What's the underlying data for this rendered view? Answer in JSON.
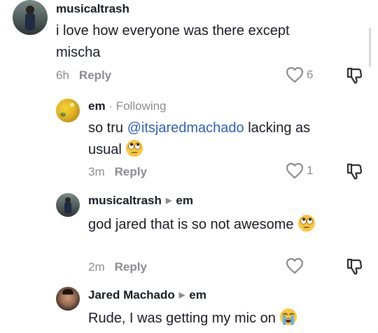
{
  "comments": [
    {
      "username": "musicaltrash",
      "text": "i love how everyone was there except mischa",
      "time": "6h",
      "reply_label": "Reply",
      "likes": "6"
    },
    {
      "username": "em",
      "following": "Following",
      "text_before": "so tru ",
      "mention": "@itsjaredmachado",
      "text_after": " lacking as usual",
      "emoji": "face-with-rolling-eyes",
      "time": "3m",
      "reply_label": "Reply",
      "likes": "1"
    },
    {
      "username": "musicaltrash",
      "reply_to": "em",
      "text": "god jared that is so not awesome",
      "emoji": "face-with-rolling-eyes",
      "time": "2m",
      "reply_label": "Reply",
      "likes": ""
    },
    {
      "username": "Jared Machado",
      "reply_to": "em",
      "text": "Rude, I was getting my mic on",
      "emoji": "loudly-crying-face"
    }
  ],
  "icons": {
    "heart": "heart-outline-icon",
    "dislike": "thumbs-down-icon",
    "reply_arrow": "caret-right-icon"
  },
  "colors": {
    "text": "#161823",
    "muted": "#8a8b91",
    "mention": "#2b5db9"
  }
}
